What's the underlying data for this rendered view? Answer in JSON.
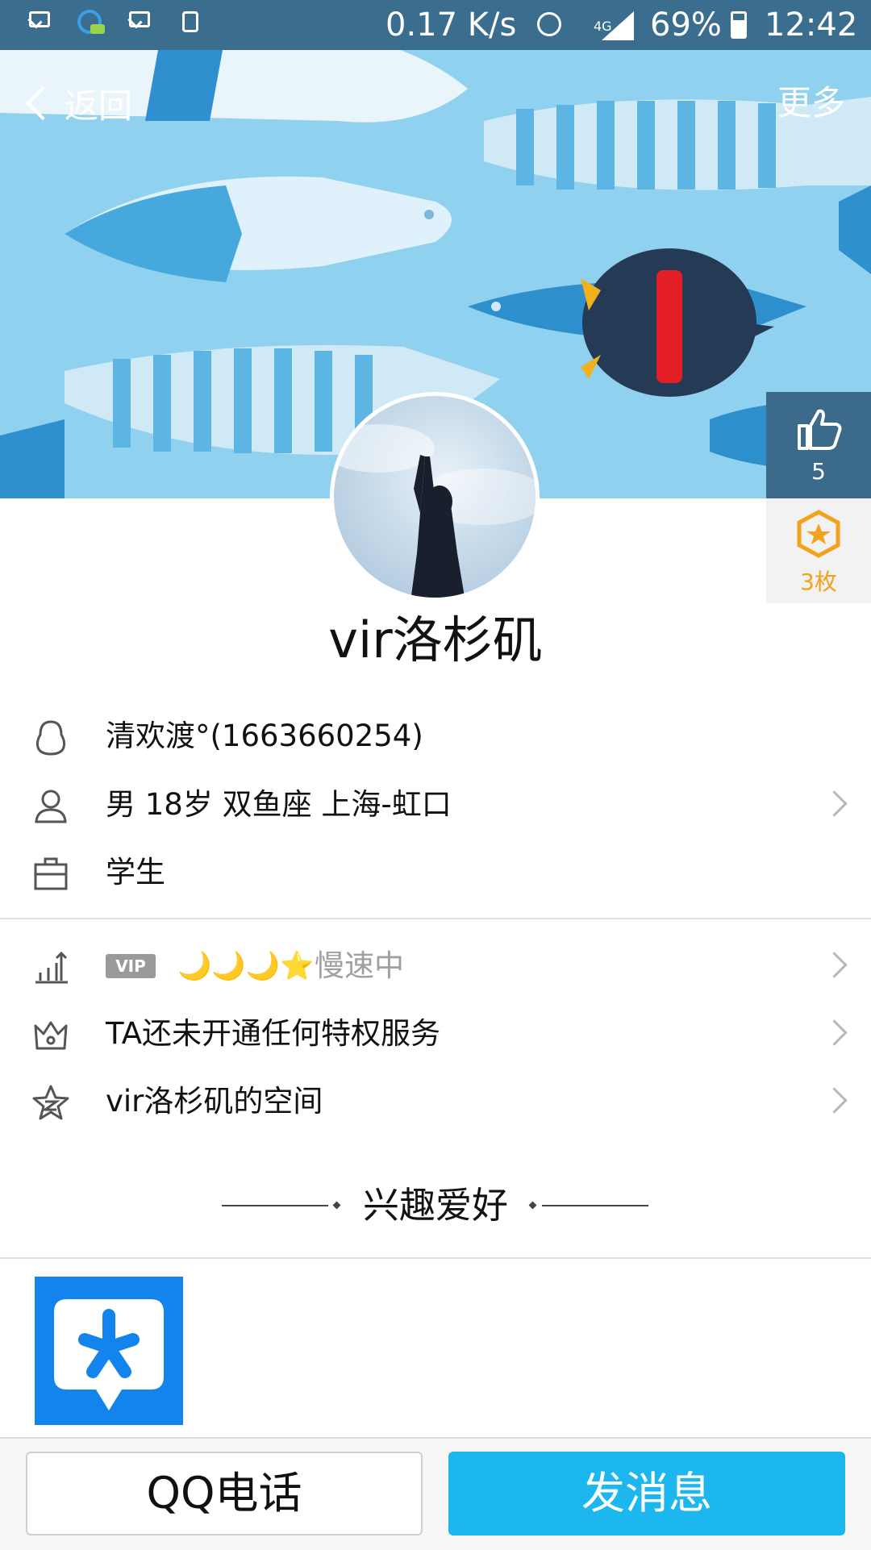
{
  "status_bar": {
    "net_speed": "0.17 K/s",
    "network": "4G",
    "battery": "69%",
    "time": "12:42",
    "icons": [
      "mail-icon",
      "qq-chat-icon",
      "mail-icon",
      "download-icon",
      "alarm-icon",
      "signal-icon",
      "battery-icon"
    ]
  },
  "header": {
    "back_label": "返回",
    "more_label": "更多"
  },
  "side": {
    "like_count": "5",
    "medal_count": "3枚"
  },
  "profile": {
    "name": "vir洛杉矶"
  },
  "info_rows": {
    "qq": "清欢渡°(1663660254)",
    "personal": "男  18岁  双鱼座  上海-虹口",
    "job": "学生",
    "level_badge": "VIP",
    "level_icons": "🌙🌙🌙⭐",
    "level_status": "慢速中",
    "privilege": "TA还未开通任何特权服务",
    "space": "vir洛杉矶的空间"
  },
  "section": {
    "title": "兴趣爱好"
  },
  "bottom": {
    "call_label": "QQ电话",
    "message_label": "发消息"
  },
  "colors": {
    "accent": "#1cb7ee",
    "cover_bg": "#8fd1ee",
    "gold": "#f2a21d"
  }
}
